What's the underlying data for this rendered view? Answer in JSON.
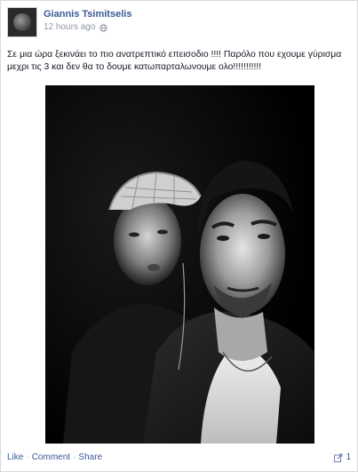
{
  "post": {
    "author": "Giannis Tsimitselis",
    "timestamp": "12 hours ago",
    "privacy_icon": "globe-icon",
    "caption": "Σε μια ώρα ξεκινάει το πιο ανατρεπτικό επεισοδιο !!!! Παρόλο που εχουμε γύρισμα μεχρι τις 3 και δεν θα το δουμε κατωπαρταλωνουμε ολο!!!!!!!!!!!",
    "actions": {
      "like": "Like",
      "comment": "Comment",
      "share": "Share",
      "separator": "·"
    },
    "share_count": "1",
    "share_icon": "share-icon"
  },
  "colors": {
    "link": "#3b5998",
    "meta": "#9197a3",
    "text": "#141823"
  }
}
